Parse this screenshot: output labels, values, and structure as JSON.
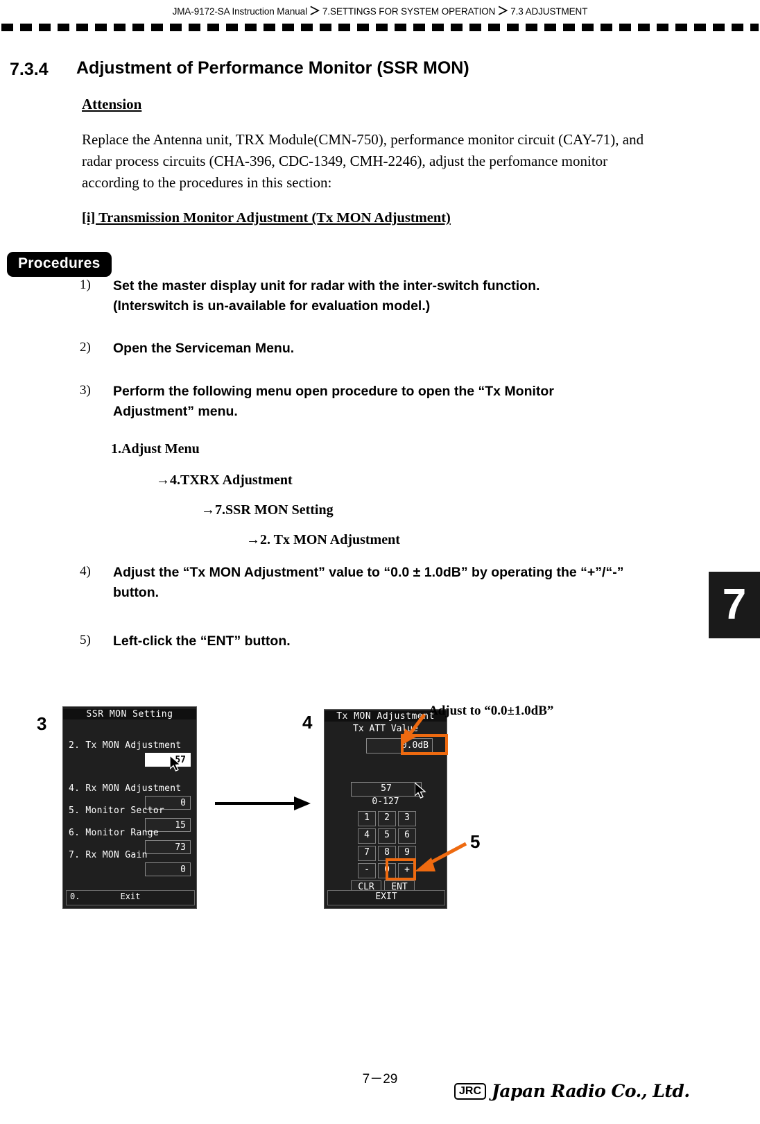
{
  "header": {
    "breadcrumb": [
      "JMA-9172-SA Instruction Manual",
      "7.SETTINGS FOR SYSTEM OPERATION",
      "7.3  ADJUSTMENT"
    ],
    "separator": "＞"
  },
  "section": {
    "number": "7.3.4",
    "title": "Adjustment of Performance Monitor (SSR MON)"
  },
  "attension": {
    "heading": "Attension",
    "body": "Replace the Antenna unit, TRX Module(CMN-750), performance monitor circuit (CAY-71), and radar process circuits (CHA-396, CDC-1349, CMH-2246), adjust the perfomance monitor according to the procedures in this section:",
    "subheading": "[i]    Transmission Monitor Adjustment (Tx MON Adjustment)"
  },
  "procedures": {
    "badge": "Procedures",
    "steps": [
      {
        "num": "1)",
        "text": "Set the master display unit for radar with the inter-switch function. (Interswitch is un-available for evaluation model.)"
      },
      {
        "num": "2)",
        "text": "Open the Serviceman Menu."
      },
      {
        "num": "3)",
        "text": "Perform the following menu open procedure to open the “Tx Monitor Adjustment” menu."
      },
      {
        "num": "4)",
        "text": "Adjust the “Tx MON Adjustment” value to “0.0 ± 1.0dB” by operating the “+”/“-” button."
      },
      {
        "num": "5)",
        "text": "Left-click the “ENT” button."
      }
    ],
    "menu_path": [
      "1.Adjust Menu",
      "→4.TXRX Adjustment",
      "→7.SSR MON Setting",
      "→2. Tx MON Adjustment"
    ]
  },
  "chapter_tab": "7",
  "panel1": {
    "title": "SSR MON Setting",
    "rows": [
      {
        "label": "2. Tx MON Adjustment",
        "value": "57",
        "highlight": true
      },
      {
        "label": "4. Rx MON Adjustment",
        "value": "0",
        "highlight": false
      },
      {
        "label": "5. Monitor Sector",
        "value": "15",
        "highlight": false
      },
      {
        "label": "6. Monitor Range",
        "value": "73",
        "highlight": false
      },
      {
        "label": "7. Rx MON Gain",
        "value": "0",
        "highlight": false
      }
    ],
    "exit_num": "0.",
    "exit_label": "Exit",
    "marker": "3"
  },
  "panel2": {
    "title": "Tx MON Adjustment",
    "subtitle": "Tx ATT Value",
    "value": "0.0dB",
    "number": "57",
    "range": "0-127",
    "keys": [
      [
        "1",
        "2",
        "3"
      ],
      [
        "4",
        "5",
        "6"
      ],
      [
        "7",
        "8",
        "9"
      ],
      [
        "-",
        "0",
        "+"
      ]
    ],
    "clear_label": "CLR",
    "enter_label": "ENT",
    "exit_label": "EXIT",
    "marker": "4",
    "marker_ent": "5"
  },
  "annotations": {
    "adjust_note": "Adjust to “0.0±1.0dB”",
    "accent_color": "#ee6a10"
  },
  "footer": {
    "page": "7－29",
    "logo_mark": "JRC",
    "logo_word": "Japan Radio Co., Ltd."
  }
}
